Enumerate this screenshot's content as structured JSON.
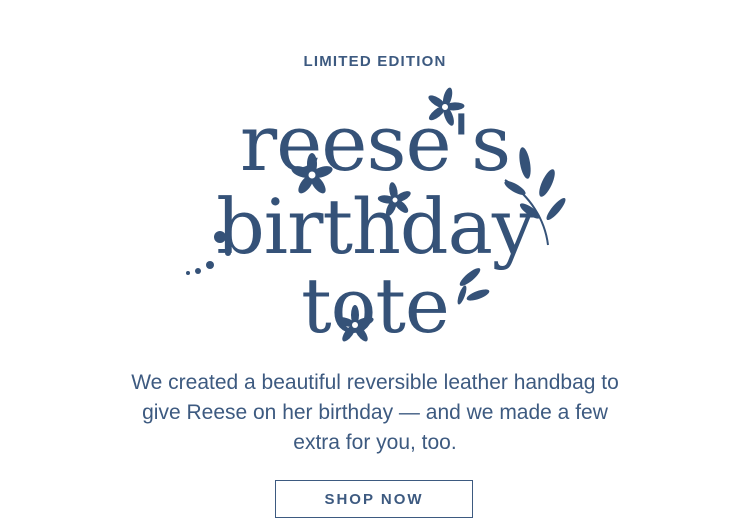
{
  "eyebrow": "LIMITED EDITION",
  "hero": {
    "line1": "reese's",
    "line2": "birthday",
    "line3": "tote"
  },
  "body_copy": "We created a beautiful reversible leather handbag to give Reese on her birthday — and we made a few extra for you, too.",
  "cta_label": "SHOP NOW",
  "colors": {
    "brand": "#3d5a80",
    "background": "#ffffff"
  },
  "icons": [
    "flower-icon",
    "leaf-sprig-icon",
    "dot-accent"
  ]
}
